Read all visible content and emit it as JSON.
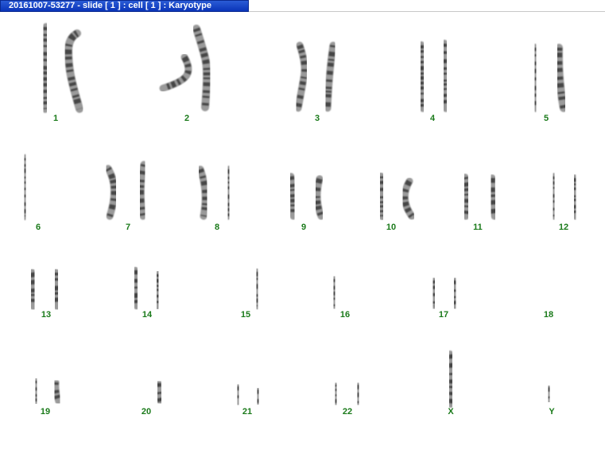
{
  "window": {
    "title": "20161007-53277 - slide [ 1 ] : cell [ 1 ] : Karyotype"
  },
  "karyotype": {
    "label_color": "#1a7a1a",
    "chromosomes": [
      {
        "label": "1"
      },
      {
        "label": "2"
      },
      {
        "label": "3"
      },
      {
        "label": "4"
      },
      {
        "label": "5"
      },
      {
        "label": "6"
      },
      {
        "label": "7"
      },
      {
        "label": "8"
      },
      {
        "label": "9"
      },
      {
        "label": "10"
      },
      {
        "label": "11"
      },
      {
        "label": "12"
      },
      {
        "label": "13"
      },
      {
        "label": "14"
      },
      {
        "label": "15"
      },
      {
        "label": "16"
      },
      {
        "label": "17"
      },
      {
        "label": "18"
      },
      {
        "label": "19"
      },
      {
        "label": "20"
      },
      {
        "label": "21"
      },
      {
        "label": "22"
      },
      {
        "label": "X"
      },
      {
        "label": "Y"
      }
    ]
  }
}
